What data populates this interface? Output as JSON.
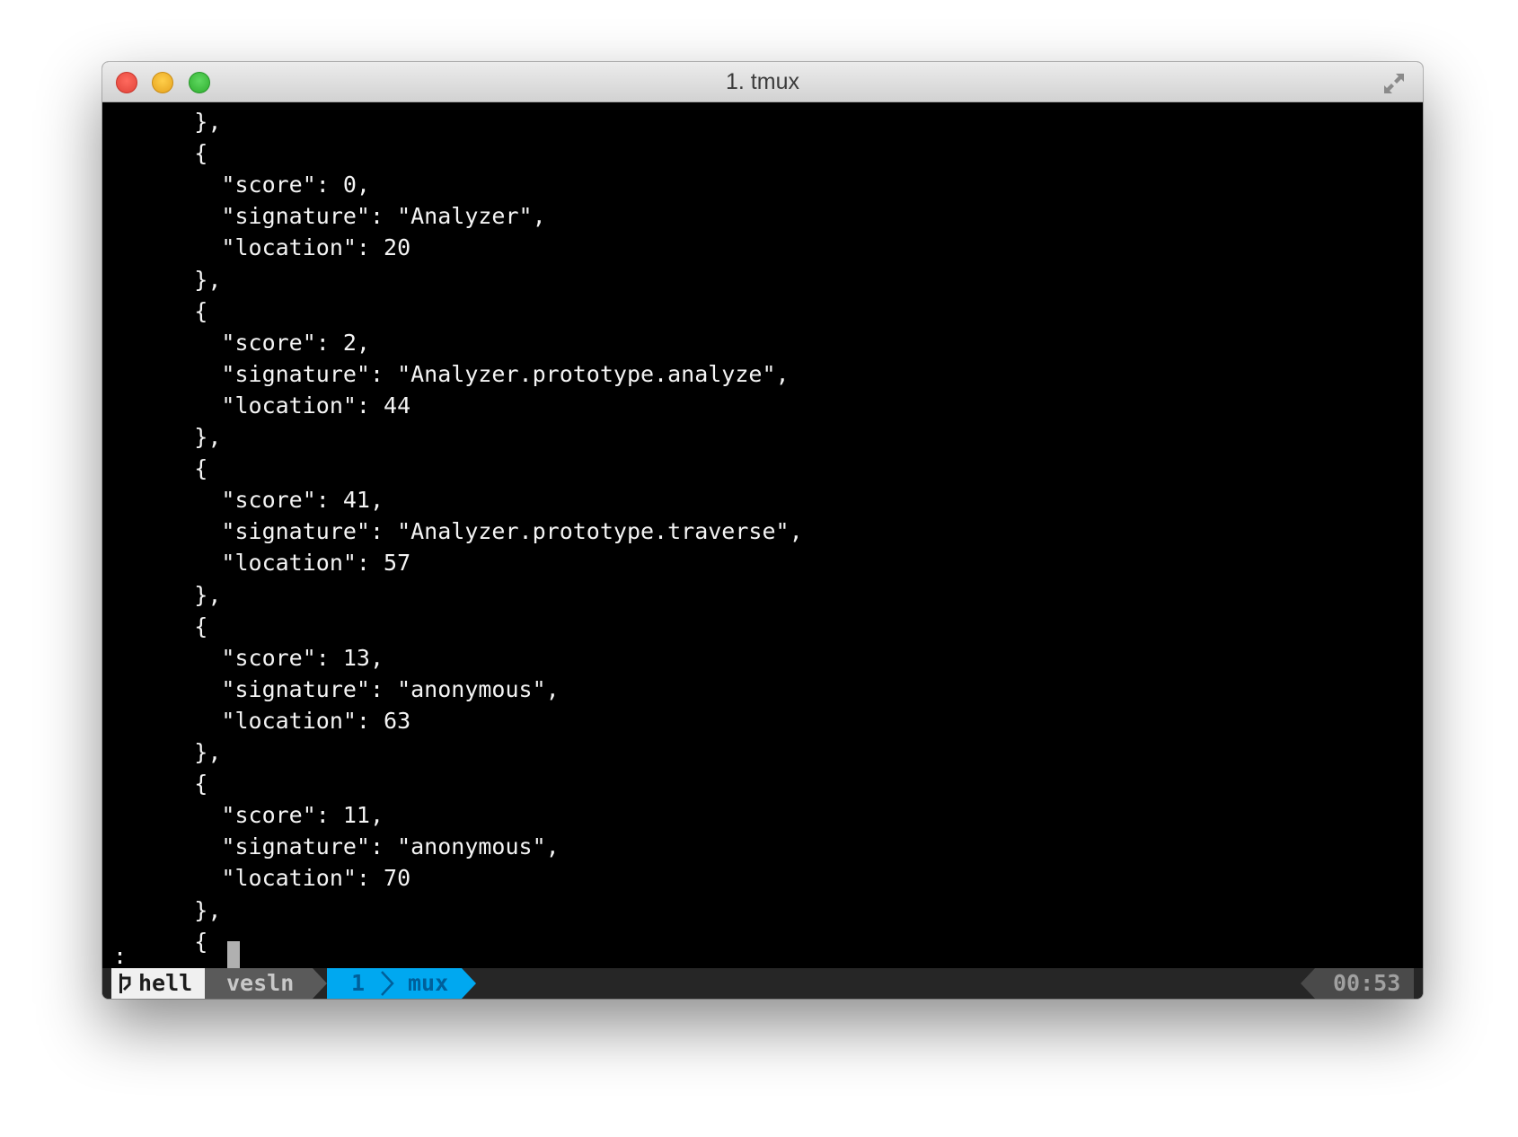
{
  "window": {
    "title": "1. tmux"
  },
  "terminal": {
    "lines": [
      "      },",
      "      {",
      "        \"score\": 0,",
      "        \"signature\": \"Analyzer\",",
      "        \"location\": 20",
      "      },",
      "      {",
      "        \"score\": 2,",
      "        \"signature\": \"Analyzer.prototype.analyze\",",
      "        \"location\": 44",
      "      },",
      "      {",
      "        \"score\": 41,",
      "        \"signature\": \"Analyzer.prototype.traverse\",",
      "        \"location\": 57",
      "      },",
      "      {",
      "        \"score\": 13,",
      "        \"signature\": \"anonymous\",",
      "        \"location\": 63",
      "      },",
      "      {",
      "        \"score\": 11,",
      "        \"signature\": \"anonymous\",",
      "        \"location\": 70",
      "      },",
      "      {"
    ],
    "prompt": ":"
  },
  "statusbar": {
    "session": "hell",
    "host": "vesln",
    "window_index": "1",
    "window_name": "mux",
    "time": "00:53",
    "colors": {
      "session_bg": "#f0f0f0",
      "host_bg": "#5a5a5a",
      "active_window_bg": "#00a8f0",
      "time_bg": "#4a4a4a"
    }
  },
  "icons": {
    "close": "close-dot-icon",
    "minimize": "minimize-dot-icon",
    "zoom": "zoom-dot-icon",
    "fullscreen": "fullscreen-arrows-icon",
    "session": "branch-icon",
    "separator": "chevron-right-icon"
  }
}
